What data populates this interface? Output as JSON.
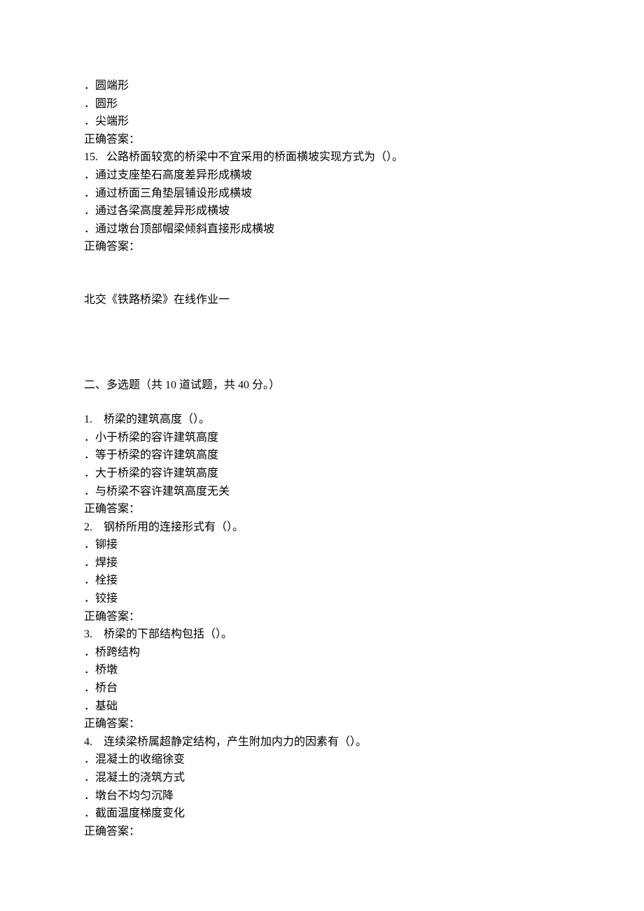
{
  "top_options": [
    "．圆端形",
    "．圆形",
    "．尖端形"
  ],
  "top_answer_label": "正确答案：",
  "q15": {
    "stem": "15.   公路桥面较宽的桥梁中不宜采用的桥面横坡实现方式为（）。",
    "options": [
      "．通过支座垫石高度差异形成横坡",
      "．通过桥面三角垫层铺设形成横坡",
      "．通过各梁高度差异形成横坡",
      "．通过墩台顶部帽梁倾斜直接形成横坡"
    ],
    "answer_label": "正确答案："
  },
  "section_title": "北交《铁路桥梁》在线作业一",
  "part2_heading": "二、多选题（共 10 道试题，共 40 分。）",
  "mcq": [
    {
      "stem": "1.    桥梁的建筑高度（）。",
      "options": [
        "．小于桥梁的容许建筑高度",
        "．等于桥梁的容许建筑高度",
        "．大于桥梁的容许建筑高度",
        "．与桥梁不容许建筑高度无关"
      ],
      "answer_label": "正确答案："
    },
    {
      "stem": "2.    钢桥所用的连接形式有（）。",
      "options": [
        "．铆接",
        "．焊接",
        "．栓接",
        "．铰接"
      ],
      "answer_label": "正确答案："
    },
    {
      "stem": "3.    桥梁的下部结构包括（）。",
      "options": [
        "．桥跨结构",
        "．桥墩",
        "．桥台",
        "．基础"
      ],
      "answer_label": "正确答案："
    },
    {
      "stem": "4.    连续梁桥属超静定结构，产生附加内力的因素有（）。",
      "options": [
        "．混凝土的收缩徐变",
        "．混凝土的浇筑方式",
        "．墩台不均匀沉降",
        "．截面温度梯度变化"
      ],
      "answer_label": "正确答案："
    }
  ]
}
